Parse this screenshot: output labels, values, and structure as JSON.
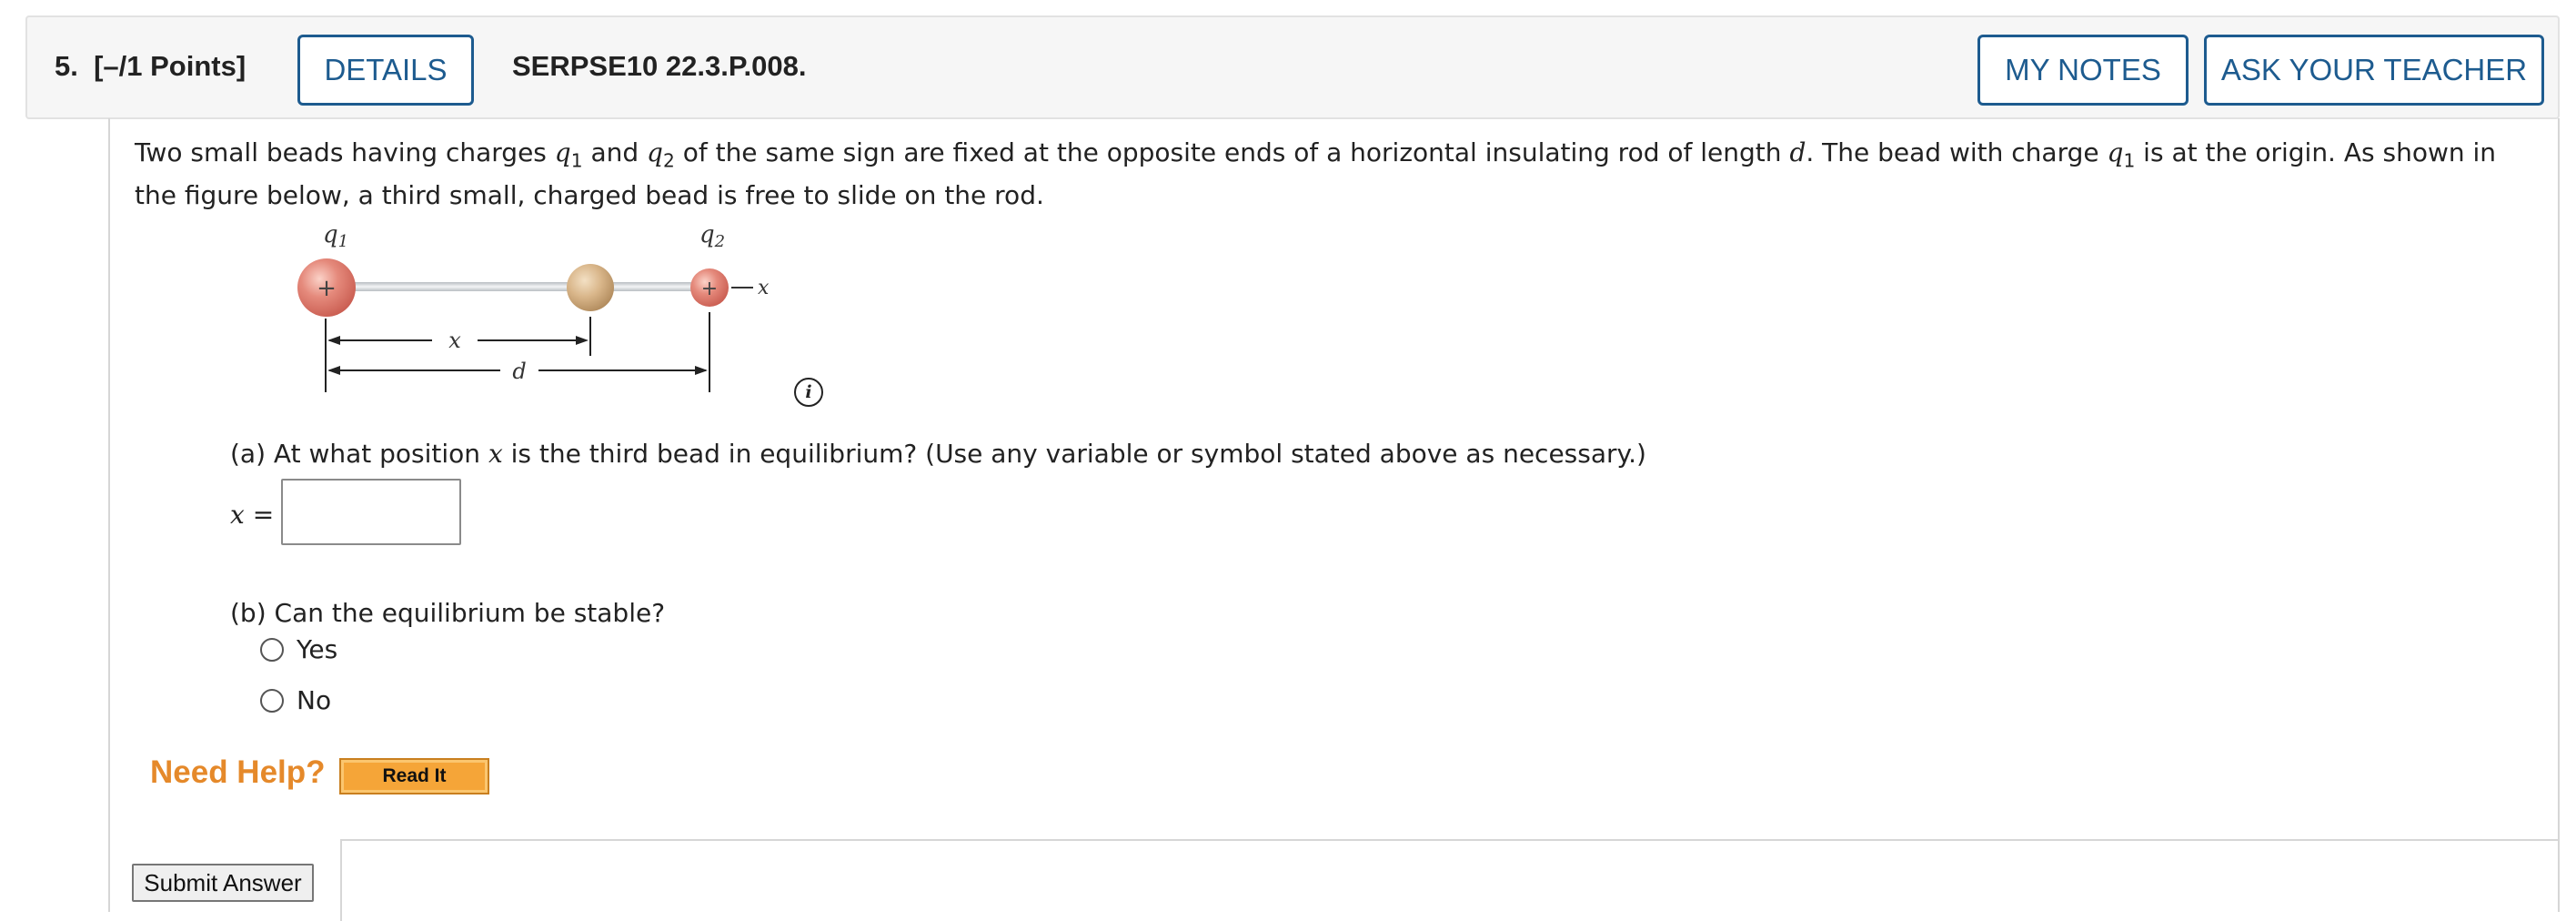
{
  "header": {
    "question_number": "5.",
    "points": "[–/1 Points]",
    "details_label": "DETAILS",
    "problem_code": "SERPSE10 22.3.P.008.",
    "my_notes_label": "MY NOTES",
    "ask_teacher_label": "ASK YOUR TEACHER"
  },
  "problem": {
    "t1": "Two small beads having charges ",
    "q": "q",
    "sub1": "1",
    "t2": " and ",
    "sub2": "2",
    "t3": " of the same sign are fixed at the opposite ends of a horizontal insulating rod of length ",
    "d": "d",
    "t4": ". The bead with charge ",
    "t5": " is at the origin. As shown in the figure below, a third small, charged bead is free to slide on the rod."
  },
  "figure": {
    "label_q1": "q",
    "label_q1_sub": "1",
    "label_q2": "q",
    "label_q2_sub": "2",
    "axis_label": "x",
    "plus_sign": "+",
    "dim_x_label": "x",
    "dim_d_label": "d",
    "colors": {
      "charge_bead": "#e0766a",
      "third_bead": "#d2aa78",
      "rod": "#cfd3d6"
    }
  },
  "info_icon": {
    "glyph": "i"
  },
  "part_a": {
    "prompt_start": "(a) At what position ",
    "prompt_var": "x",
    "prompt_end": " is the third bead in equilibrium? (Use any variable or symbol stated above as necessary.)",
    "answer_var": "x",
    "answer_eq": " =",
    "answer_value": ""
  },
  "part_b": {
    "prompt": "(b) Can the equilibrium be stable?",
    "options": [
      "Yes",
      "No"
    ]
  },
  "help": {
    "need_help": "Need Help?",
    "read_it": "Read It"
  },
  "submit_label": "Submit Answer"
}
